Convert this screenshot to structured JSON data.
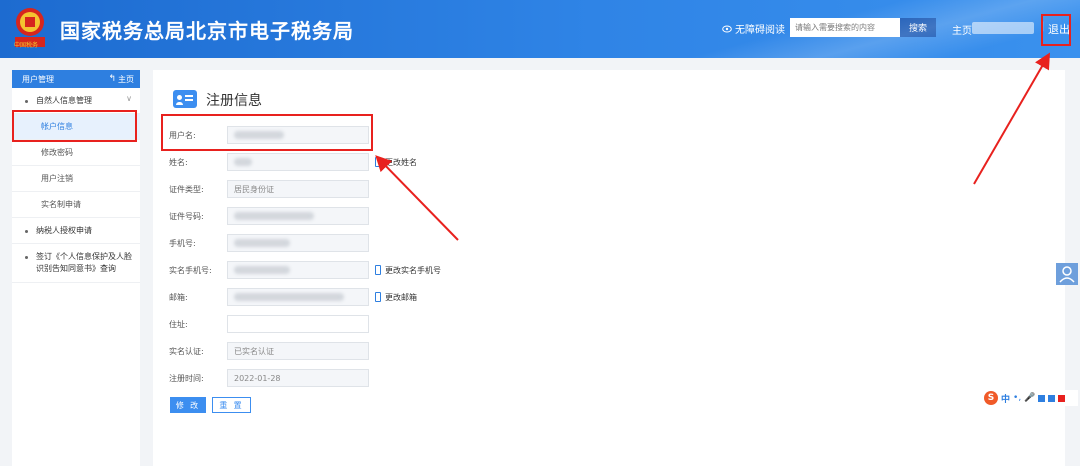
{
  "header": {
    "title": "国家税务总局北京市电子税务局",
    "logo_text": "中国税务",
    "accessible_reading": "无障碍阅读",
    "search_placeholder": "请输入需要搜索的内容",
    "search_button": "搜索",
    "home": "主页",
    "separator": "|",
    "logout": "退出"
  },
  "sidebar": {
    "title": "用户管理",
    "home_link": "主页",
    "groups": [
      {
        "label": "自然人信息管理",
        "items": [
          "帐户信息",
          "修改密码",
          "用户注销",
          "实名制申请"
        ]
      },
      {
        "label": "纳税人授权申请"
      },
      {
        "label": "签订《个人信息保护及人脸识别告知同意书》查询"
      }
    ]
  },
  "main": {
    "title": "注册信息",
    "fields": [
      {
        "label": "用户名:"
      },
      {
        "label": "姓名:",
        "action": "更改姓名"
      },
      {
        "label": "证件类型:",
        "value": "居民身份证"
      },
      {
        "label": "证件号码:"
      },
      {
        "label": "手机号:"
      },
      {
        "label": "实名手机号:",
        "action": "更改实名手机号"
      },
      {
        "label": "邮箱:",
        "action": "更改邮箱"
      },
      {
        "label": "住址:"
      },
      {
        "label": "实名认证:",
        "value": "已实名认证"
      },
      {
        "label": "注册时间:",
        "value": "2022-01-28"
      }
    ],
    "modify_button": "修 改",
    "reset_button": "重 置"
  },
  "ime": {
    "lang": "中",
    "punct": "•,"
  },
  "colors": {
    "header": "#2f84e6",
    "accent": "#2e7fe0",
    "annotation": "#e8211e"
  },
  "icons": [
    "tax-emblem-icon",
    "eye-icon",
    "back-arrow-icon",
    "chevron-down-icon",
    "id-card-icon",
    "phone-icon",
    "user-float-icon",
    "sogou-ime-icon",
    "microphone-icon",
    "keyboard-icon",
    "shirt-icon",
    "grid-icon"
  ]
}
